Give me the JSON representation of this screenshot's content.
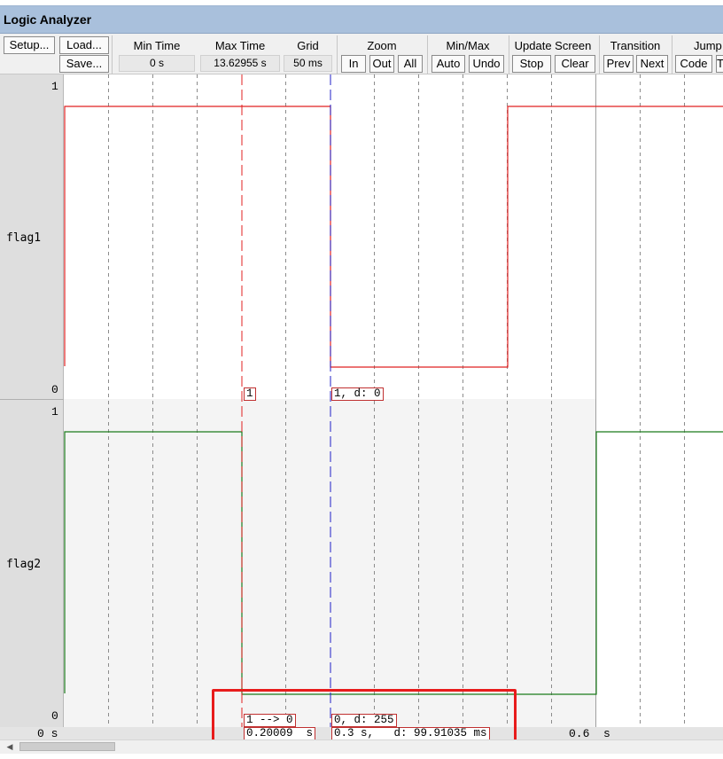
{
  "window": {
    "title": "Logic Analyzer"
  },
  "toolbar": {
    "setup_label": "Setup...",
    "load_label": "Load...",
    "save_label": "Save...",
    "min_time": {
      "label": "Min Time",
      "value": "0 s"
    },
    "max_time": {
      "label": "Max Time",
      "value": "13.62955 s"
    },
    "grid": {
      "label": "Grid",
      "value": "50 ms"
    },
    "zoom": {
      "label": "Zoom",
      "in": "In",
      "out": "Out",
      "all": "All"
    },
    "minmax": {
      "label": "Min/Max",
      "auto": "Auto",
      "undo": "Undo"
    },
    "update_screen": {
      "label": "Update Screen",
      "stop": "Stop",
      "clear": "Clear"
    },
    "transition": {
      "label": "Transition",
      "prev": "Prev",
      "next": "Next"
    },
    "jump": {
      "label": "Jump t",
      "code": "Code",
      "trace": "T"
    }
  },
  "signals": [
    {
      "name": "flag1",
      "high_label": "1",
      "low_label": "0",
      "color": "#e02020",
      "cursor_tag": "1",
      "cursor2_tag": "1,  d: 0"
    },
    {
      "name": "flag2",
      "high_label": "1",
      "low_label": "0",
      "color": "#1a7a1a",
      "cursor_tag": "1 --> 0",
      "cursor2_tag": "0,  d: 255"
    }
  ],
  "time_axis": {
    "start_label": "0 s",
    "mid_label": "0.6  s",
    "cursor_time": "0.20009  s",
    "cursor2_time": "0.3 s,   d: 99.91035 ms"
  },
  "colors": {
    "cursor": "#e02020",
    "cursor2": "#2020c8",
    "highlight": "#e81c1c"
  }
}
